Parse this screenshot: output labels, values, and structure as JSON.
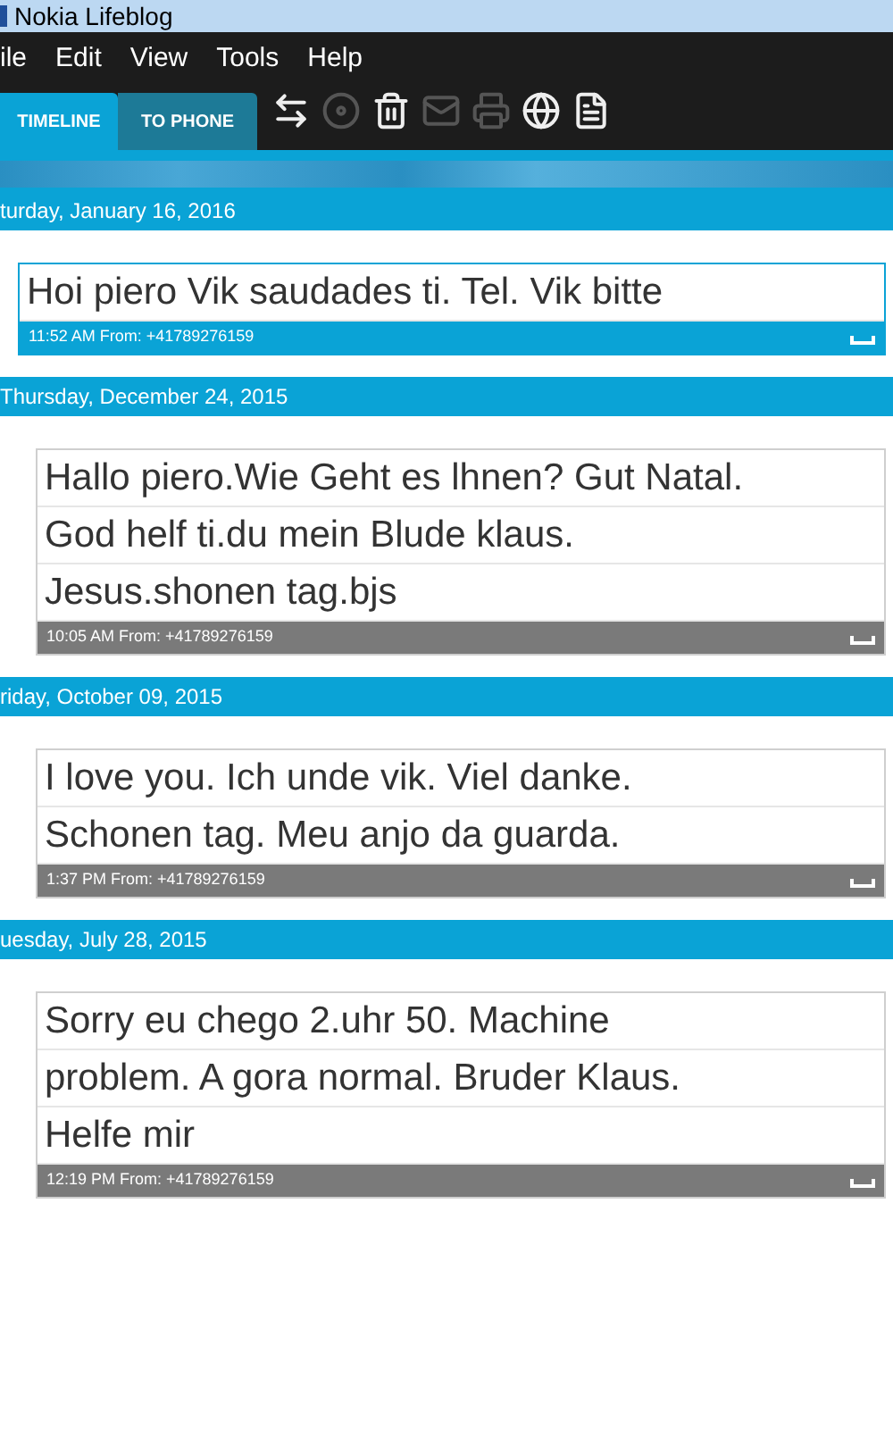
{
  "window": {
    "title": "Nokia Lifeblog"
  },
  "menu": [
    "ile",
    "Edit",
    "View",
    "Tools",
    "Help"
  ],
  "tabs": [
    {
      "label": "TIMELINE",
      "selected": true
    },
    {
      "label": "TO PHONE",
      "selected": false
    }
  ],
  "days": [
    {
      "date": "turday, January 16, 2016",
      "messages": [
        {
          "lines": [
            "Hoi piero Vik saudades ti. Tel. Vik bitte"
          ],
          "meta": "11:52 AM From: +41789276159",
          "selected": true
        }
      ]
    },
    {
      "date": "Thursday, December 24, 2015",
      "messages": [
        {
          "lines": [
            "Hallo piero.Wie Geht es lhnen? Gut Natal.",
            "God helf ti.du mein Blude klaus.",
            "Jesus.shonen tag.bjs"
          ],
          "meta": "10:05 AM From: +41789276159",
          "selected": false
        }
      ]
    },
    {
      "date": "riday, October 09, 2015",
      "messages": [
        {
          "lines": [
            "I love you. Ich unde vik. Viel danke.",
            "Schonen tag. Meu anjo da guarda."
          ],
          "meta": "1:37 PM From: +41789276159",
          "selected": false
        }
      ]
    },
    {
      "date": "uesday, July 28, 2015",
      "messages": [
        {
          "lines": [
            "Sorry  eu chego 2.uhr 50. Machine",
            "problem. A gora normal. Bruder Klaus.",
            "Helfe mir"
          ],
          "meta": "12:19 PM From: +41789276159",
          "selected": false
        }
      ]
    }
  ]
}
